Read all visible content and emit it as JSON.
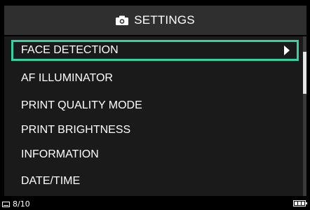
{
  "header": {
    "title": "SETTINGS",
    "icon": "camera-icon"
  },
  "menu": {
    "items": [
      {
        "label": "FACE DETECTION",
        "selected": true,
        "has_submenu": true
      },
      {
        "label": "AF ILLUMINATOR"
      },
      {
        "label": "PRINT QUALITY MODE"
      },
      {
        "label": "PRINT BRIGHTNESS"
      },
      {
        "label": "INFORMATION"
      },
      {
        "label": "DATE/TIME"
      }
    ]
  },
  "status": {
    "page": "8/10",
    "page_icon": "page-icon",
    "battery_icon": "battery-icon"
  },
  "colors": {
    "selection_border": "#35d3a4",
    "header_bg": "#2f2f2f",
    "panel_bg": "#1a1a1a",
    "background": "#000000"
  }
}
